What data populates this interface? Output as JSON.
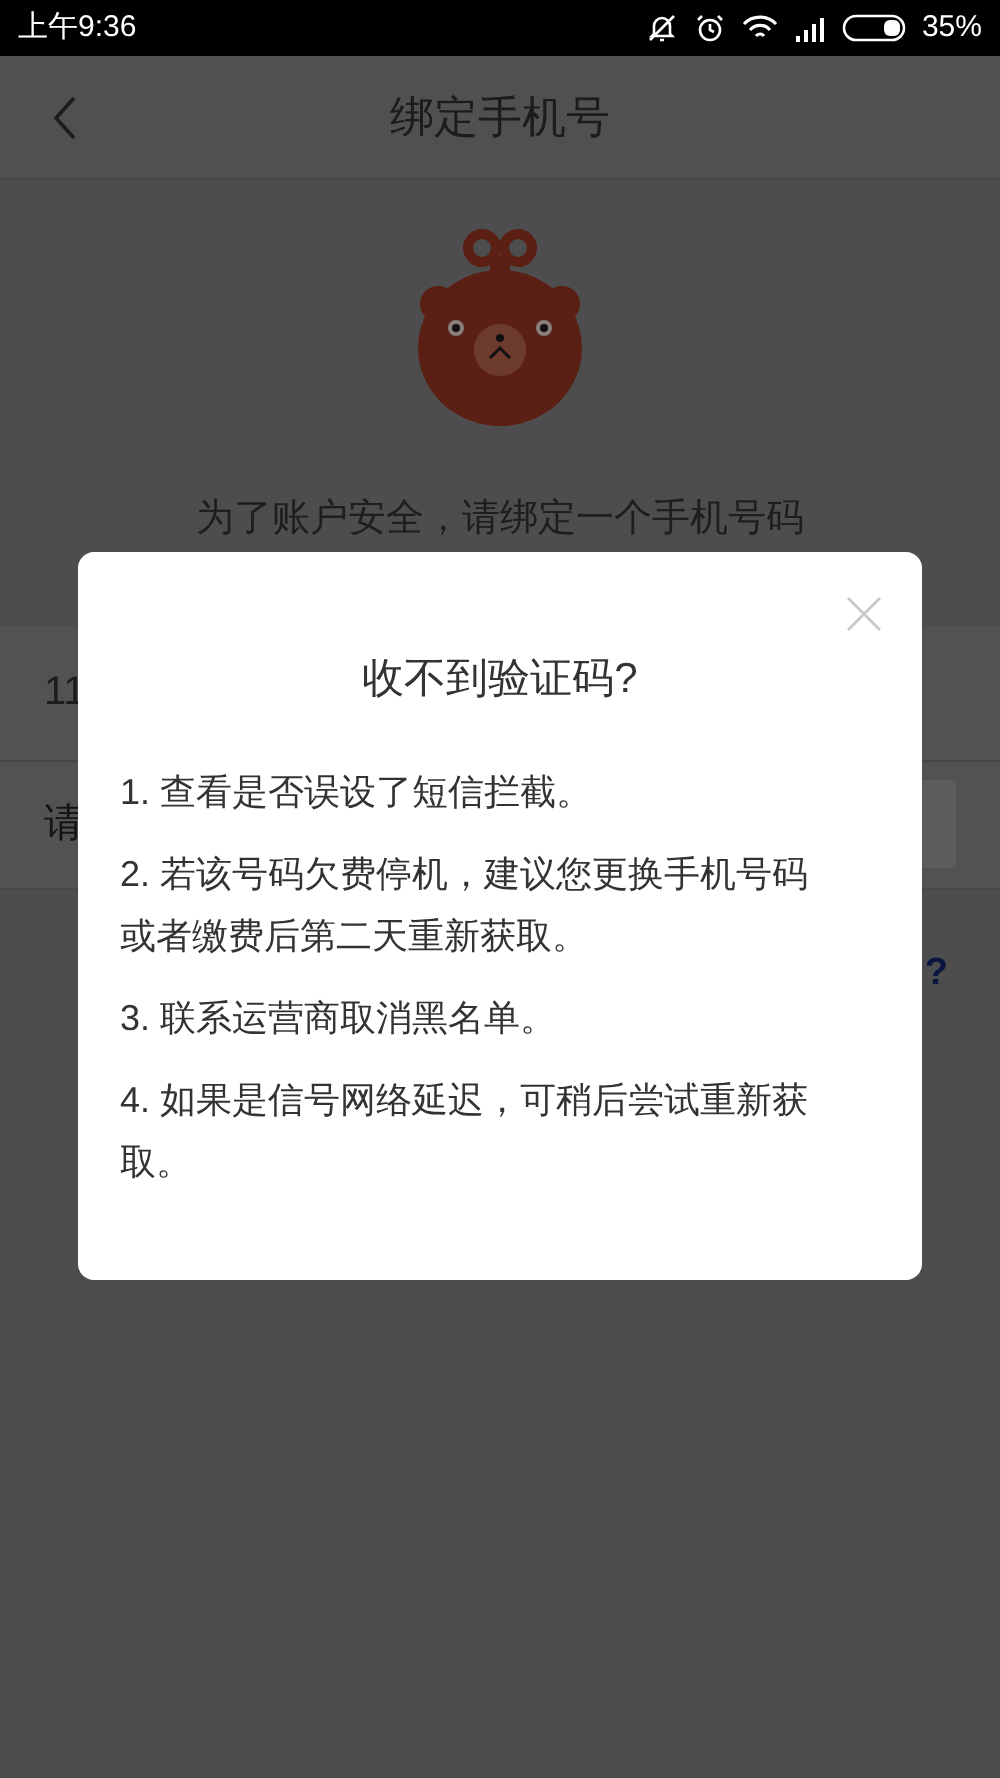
{
  "status_bar": {
    "time": "上午9:36",
    "battery": "35%"
  },
  "header": {
    "title": "绑定手机号"
  },
  "prompt": "为了账户安全，请绑定一个手机号码",
  "phone_field": {
    "value": "11"
  },
  "code_field": {
    "placeholder": "请"
  },
  "help_link": "?",
  "dialog": {
    "title": "收不到验证码?",
    "items": [
      "1. 查看是否误设了短信拦截。",
      "2. 若该号码欠费停机，建议您更换手机号码或者缴费后第二天重新获取。",
      "3. 联系运营商取消黑名单。",
      "4. 如果是信号网络延迟，可稍后尝试重新获取。"
    ]
  }
}
